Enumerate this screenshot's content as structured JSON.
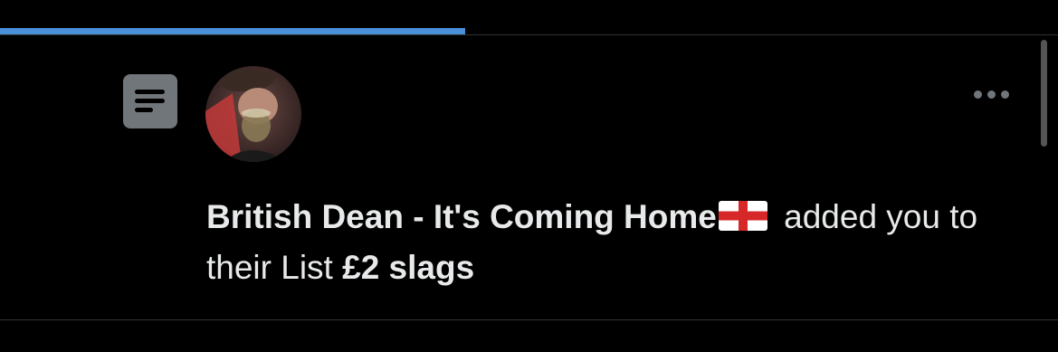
{
  "progress": {
    "fraction": 0.44,
    "color": "#4a90d9"
  },
  "notification": {
    "type_icon": "list-icon",
    "user": {
      "display_name": "British Dean - It's Coming Home",
      "name_emoji": "england-flag-icon",
      "avatar": "user-avatar-photo"
    },
    "text_mid": "added you to their List",
    "list_name": "£2 slags",
    "more_icon": "more-horizontal-icon"
  },
  "colors": {
    "background": "#000000",
    "text": "#e7e9ea",
    "muted": "#71767b",
    "divider": "#2f3336"
  }
}
